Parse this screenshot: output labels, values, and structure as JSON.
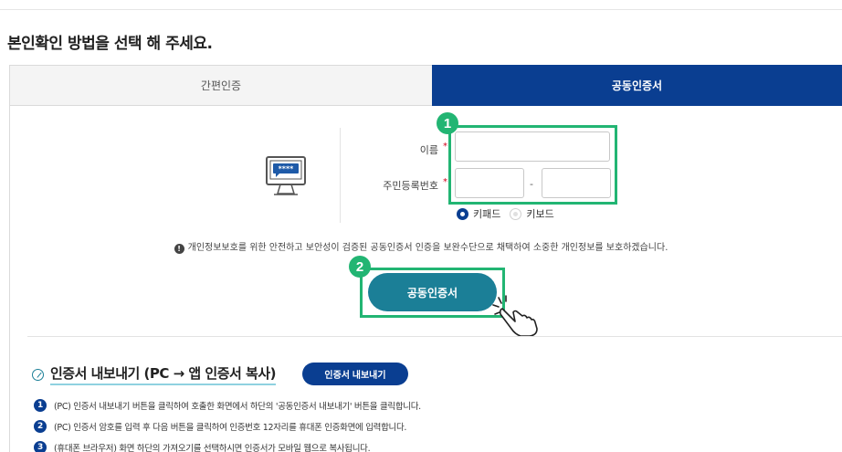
{
  "page_title": "본인확인 방법을 선택 해 주세요.",
  "tabs": [
    {
      "label": "간편인증",
      "active": false
    },
    {
      "label": "공동인증서",
      "active": true
    }
  ],
  "form": {
    "name_label": "이름",
    "rrn_label": "주민등록번호",
    "required_mark": "*",
    "name_value": "",
    "rrn_front_value": "",
    "rrn_back_value": "",
    "rrn_separator": "-",
    "input_options": [
      {
        "label": "키패드",
        "selected": true
      },
      {
        "label": "키보드",
        "selected": false
      }
    ]
  },
  "callouts": {
    "step1": "1",
    "step2": "2"
  },
  "notice": "개인정보보호를 위한 안전하고 보안성이 검증된 공동인증서 인증을 보완수단으로 채택하여 소중한 개인정보를 보호하겠습니다.",
  "cert_button_label": "공동인증서",
  "export_section": {
    "title": "인증서 내보내기 (PC → 앱 인증서 복사)",
    "button_label": "인증서 내보내기",
    "steps": [
      {
        "num": "1",
        "text": "(PC) 인증서 내보내기 버튼을 클릭하여 호출한 화면에서 하단의 '공동인증서 내보내기' 버튼을 클릭합니다."
      },
      {
        "num": "2",
        "text": "(PC) 인증서 암호를 입력 후 다음 버튼을 클릭하여 인증번호 12자리를 휴대폰 인증화면에 입력합니다."
      },
      {
        "num": "3",
        "text": "(휴대폰 브라우저) 화면 하단의 가져오기를 선택하시면 인증서가 모바일 웹으로 복사됩니다."
      }
    ]
  },
  "colors": {
    "active_tab": "#0a3e91",
    "highlight": "#22b573",
    "cert_button": "#1b7f97",
    "required": "#d0021b"
  },
  "icons": [
    "monitor-password-icon",
    "pointing-hand-icon",
    "info-icon",
    "edit-circle-icon"
  ]
}
